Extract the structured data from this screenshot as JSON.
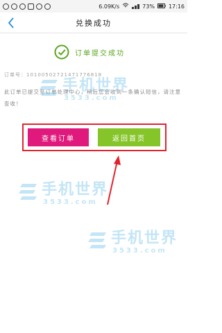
{
  "status_bar": {
    "speed": "6.09K/s",
    "battery": "73%",
    "time": "17:16"
  },
  "header": {
    "title": "兑换成功"
  },
  "success": {
    "text": "订单提交成功"
  },
  "order": {
    "label": "订单号：10100502721471776818"
  },
  "message": {
    "text": "此订单已提交至订单处理中心，稍后您会收到一条确认短信，请注意查收！"
  },
  "buttons": {
    "view_order": "查看订单",
    "back_home": "返回首页"
  },
  "watermark": {
    "name": "手机世界",
    "site": "3533.com"
  },
  "colors": {
    "accent_blue": "#2a8fd8",
    "success_green": "#5aa51f",
    "view_button": "#e01a7c",
    "home_button": "#86c52a",
    "annotation_red": "#e2232c"
  }
}
